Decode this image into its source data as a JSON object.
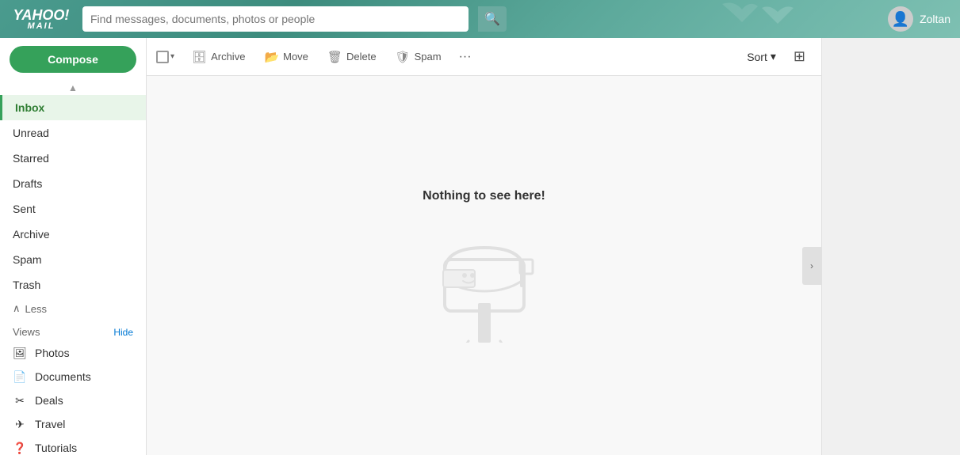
{
  "header": {
    "logo_main": "YAHOO!",
    "logo_sub": "MAIL",
    "search_placeholder": "Find messages, documents, photos or people",
    "search_icon": "🔍",
    "username": "Zoltan"
  },
  "toolbar": {
    "archive_label": "Archive",
    "move_label": "Move",
    "delete_label": "Delete",
    "spam_label": "Spam",
    "more_label": "···",
    "sort_label": "Sort",
    "sort_arrow": "▾"
  },
  "sidebar": {
    "compose_label": "Compose",
    "items": [
      {
        "id": "inbox",
        "label": "Inbox",
        "active": true
      },
      {
        "id": "unread",
        "label": "Unread",
        "active": false
      },
      {
        "id": "starred",
        "label": "Starred",
        "active": false
      },
      {
        "id": "drafts",
        "label": "Drafts",
        "active": false
      },
      {
        "id": "sent",
        "label": "Sent",
        "active": false
      },
      {
        "id": "archive",
        "label": "Archive",
        "active": false
      },
      {
        "id": "spam",
        "label": "Spam",
        "active": false
      },
      {
        "id": "trash",
        "label": "Trash",
        "active": false
      }
    ],
    "less_label": "Less",
    "views_label": "Views",
    "hide_label": "Hide",
    "views_items": [
      {
        "id": "photos",
        "label": "Photos",
        "icon": "🖼"
      },
      {
        "id": "documents",
        "label": "Documents",
        "icon": "📄"
      },
      {
        "id": "deals",
        "label": "Deals",
        "icon": "✂"
      },
      {
        "id": "travel",
        "label": "Travel",
        "icon": "✈"
      },
      {
        "id": "tutorials",
        "label": "Tutorials",
        "icon": "❓"
      }
    ]
  },
  "empty_state": {
    "title": "Nothing to see here!"
  }
}
